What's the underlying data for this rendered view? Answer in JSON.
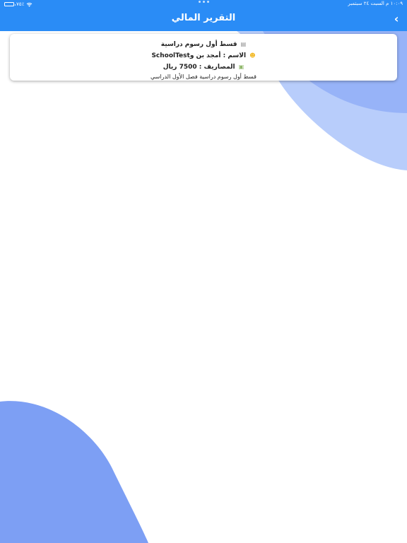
{
  "status_bar": {
    "time_date": "١٠:٠٩ م   السبت ٢٤ سبتمبر",
    "battery_text": "٧٥٪"
  },
  "nav": {
    "title": "التقرير المالي",
    "back_glyph": "‹"
  },
  "report_card": {
    "title": "قسط أول رسوم دراسية",
    "name_line": "الاسم : أمجد بن وSchoolTest",
    "expenses_line": "المصاريف : 7500 ريال",
    "description": "قسط أول رسوم دراسية فصل الأول الدراسي",
    "icons": {
      "title": "document-icon",
      "name": "smiley-face-icon",
      "expenses": "money-icon"
    }
  },
  "colors": {
    "accent": "#2a8cf6",
    "blob_light": "#b8cdfb",
    "blob_mid": "#97b3f8",
    "blob_dark": "#7d9ff4"
  }
}
